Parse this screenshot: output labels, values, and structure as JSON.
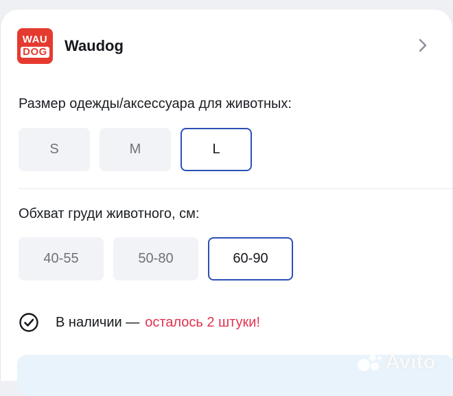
{
  "seller": {
    "logo_line1": "WAU",
    "logo_line2": "DOG",
    "name": "Waudog"
  },
  "size": {
    "label": "Размер одежды/аксессуара для животных:",
    "options": [
      "S",
      "M",
      "L"
    ],
    "selected": "L"
  },
  "girth": {
    "label": "Обхват груди животного, см:",
    "options": [
      "40-55",
      "50-80",
      "60-90"
    ],
    "selected": "60-90"
  },
  "stock": {
    "status": "В наличии —",
    "remaining": "осталось 2 штуки!"
  },
  "watermark": "Avito",
  "colors": {
    "accent_blue": "#2b4fb7",
    "alert_red": "#e0314f",
    "brand_red": "#e53a2f"
  },
  "icons": {
    "seller_chevron": "chevron-right-icon",
    "stock": "check-circle-icon"
  }
}
